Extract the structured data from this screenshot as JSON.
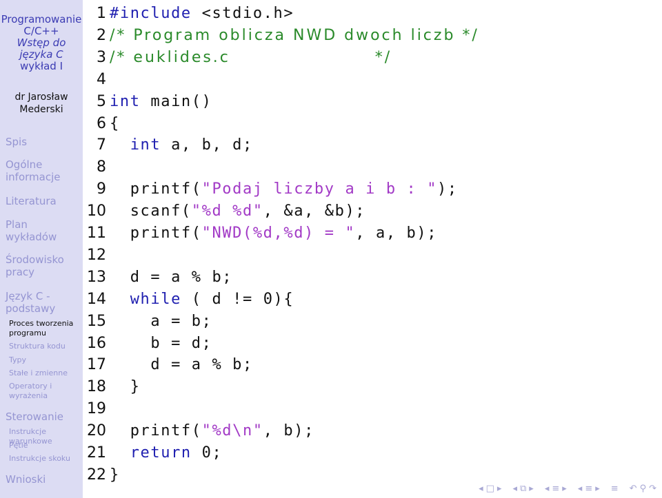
{
  "sidebar": {
    "title_line1": "Programowanie",
    "title_line2": "C/C++",
    "title_line3": "Wstęp do",
    "title_line4": "języka C",
    "title_line5": "wykład I",
    "author_line1": "dr Jarosław",
    "author_line2": "Mederski",
    "sections": [
      {
        "label": "Spis"
      },
      {
        "label_l1": "Ogólne",
        "label_l2": "informacje"
      },
      {
        "label": "Literatura"
      },
      {
        "label_l1": "Plan",
        "label_l2": "wykładów"
      },
      {
        "label_l1": "Środowisko",
        "label_l2": "pracy"
      },
      {
        "label_l1": "Język C -",
        "label_l2": "podstawy"
      },
      {
        "label": "Sterowanie"
      },
      {
        "label": "Wnioski"
      }
    ],
    "subsections": [
      {
        "label_l1": "Proces tworzenia",
        "label_l2": "programu",
        "active": true
      },
      {
        "label": "Struktura kodu"
      },
      {
        "label": "Typy"
      },
      {
        "label": "Stałe i zmienne"
      },
      {
        "label_l1": "Operatory i",
        "label_l2": "wyrażenia"
      },
      {
        "label": "Instrukcje warunkowe"
      },
      {
        "label": "Pętle"
      },
      {
        "label": "Instrukcje skoku"
      }
    ]
  },
  "code": {
    "lines": [
      {
        "n": "1",
        "parts": [
          [
            "kw",
            "#include"
          ],
          [
            "",
            " <stdio.h>"
          ]
        ]
      },
      {
        "n": "2",
        "parts": [
          [
            "cm",
            "/* Program oblicza NWD dwoch liczb */"
          ]
        ]
      },
      {
        "n": "3",
        "parts": [
          [
            "cm",
            "/* euklides.c                     */"
          ]
        ]
      },
      {
        "n": "4",
        "parts": []
      },
      {
        "n": "5",
        "parts": [
          [
            "kw",
            "int"
          ],
          [
            "",
            " main()"
          ]
        ]
      },
      {
        "n": "6",
        "parts": [
          [
            "",
            "{"
          ]
        ]
      },
      {
        "n": "7",
        "parts": [
          [
            "",
            "  "
          ],
          [
            "kw",
            "int"
          ],
          [
            "",
            " a, b, d;"
          ]
        ]
      },
      {
        "n": "8",
        "parts": []
      },
      {
        "n": "9",
        "parts": [
          [
            "",
            "  printf("
          ],
          [
            "st",
            "\"Podaj liczby a i b : \""
          ],
          [
            "",
            ");"
          ]
        ]
      },
      {
        "n": "10",
        "parts": [
          [
            "",
            "  scanf("
          ],
          [
            "st",
            "\"%d %d\""
          ],
          [
            "",
            ", &a, &b);"
          ]
        ]
      },
      {
        "n": "11",
        "parts": [
          [
            "",
            "  printf("
          ],
          [
            "st",
            "\"NWD(%d,%d) = \""
          ],
          [
            "",
            ", a, b);"
          ]
        ]
      },
      {
        "n": "12",
        "parts": []
      },
      {
        "n": "13",
        "parts": [
          [
            "",
            "  d = a % b;"
          ]
        ]
      },
      {
        "n": "14",
        "parts": [
          [
            "",
            "  "
          ],
          [
            "kw",
            "while"
          ],
          [
            "",
            " ( d != 0){"
          ]
        ]
      },
      {
        "n": "15",
        "parts": [
          [
            "",
            "    a = b;"
          ]
        ]
      },
      {
        "n": "16",
        "parts": [
          [
            "",
            "    b = d;"
          ]
        ]
      },
      {
        "n": "17",
        "parts": [
          [
            "",
            "    d = a % b;"
          ]
        ]
      },
      {
        "n": "18",
        "parts": [
          [
            "",
            "  }"
          ]
        ]
      },
      {
        "n": "19",
        "parts": []
      },
      {
        "n": "20",
        "parts": [
          [
            "",
            "  printf("
          ],
          [
            "st",
            "\"%d\\n\""
          ],
          [
            "",
            ", b);"
          ]
        ]
      },
      {
        "n": "21",
        "parts": [
          [
            "",
            "  "
          ],
          [
            "kw",
            "return"
          ],
          [
            "",
            " 0;"
          ]
        ]
      },
      {
        "n": "22",
        "parts": [
          [
            "",
            "}"
          ]
        ]
      }
    ]
  },
  "nav": {
    "icons": [
      "frame-prev-icon",
      "frame-icon",
      "frame-next-icon",
      "subsection-prev-icon",
      "subsection-icon",
      "subsection-next-icon",
      "section-prev-icon",
      "section-icon",
      "section-next-icon",
      "slide-prev-icon",
      "slide-icon",
      "slide-next-icon",
      "outline-icon",
      "undo-icon",
      "search-icon",
      "redo-icon"
    ],
    "glyphs": [
      "◂",
      "□",
      "▸",
      "◂",
      "⧉",
      "▸",
      "◂",
      "≡",
      "▸",
      "◂",
      "≡",
      "▸",
      "≡",
      "↶",
      "⚲",
      "↷"
    ]
  },
  "colors": {
    "sidebar_bg": "#dcdcf3",
    "title": "#3b3bb3",
    "nav_inactive": "#9595d2",
    "keyword": "#2020b0",
    "comment": "#2a8a2a",
    "string": "#a23ac6"
  }
}
